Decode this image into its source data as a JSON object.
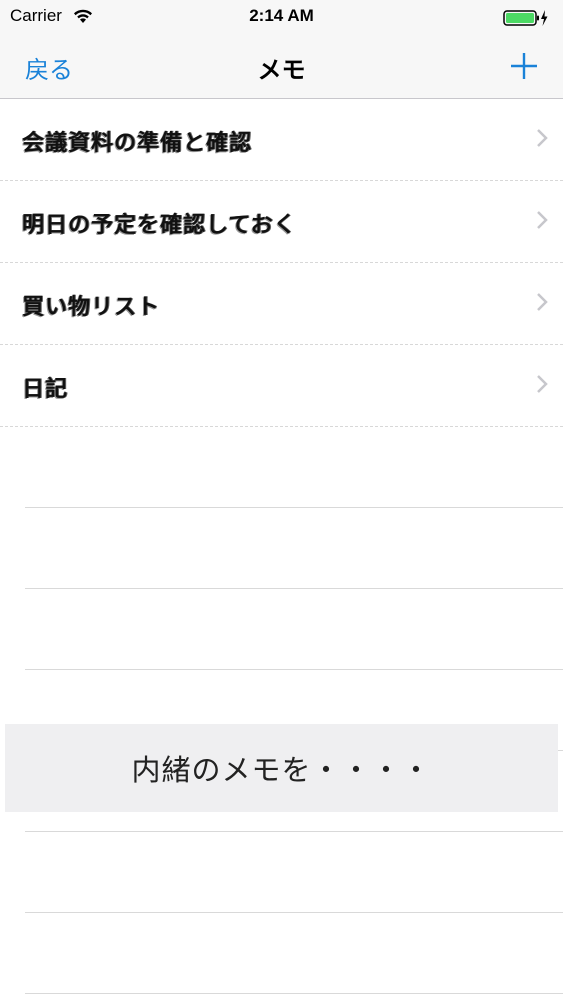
{
  "status_bar": {
    "carrier": "Carrier",
    "time": "2:14 AM",
    "wifi_icon": "wifi-icon",
    "battery_icon": "battery-charging-icon",
    "battery_color": "#4cd964"
  },
  "nav": {
    "back_label": "戻る",
    "title": "メモ",
    "add_icon": "plus-icon",
    "accent_color": "#1a82d8"
  },
  "memos": [
    {
      "text": "会議資料の準備と確認"
    },
    {
      "text": "明日の予定を確認しておく"
    },
    {
      "text": "買い物リスト"
    },
    {
      "text": "日記"
    }
  ],
  "toast": {
    "message": "内緒のメモを・・・・"
  }
}
